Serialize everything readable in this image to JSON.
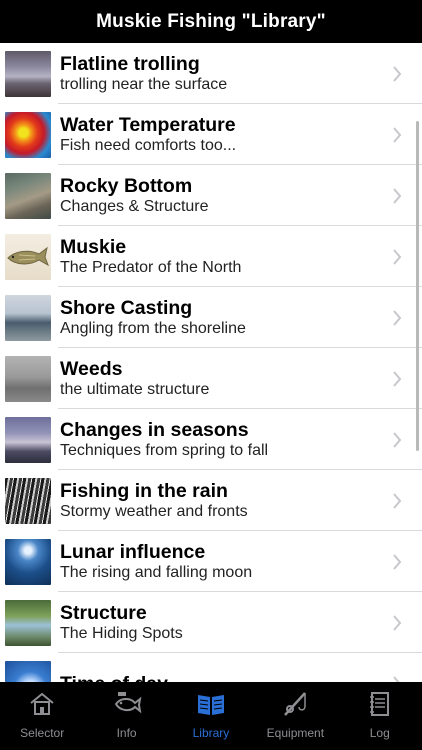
{
  "header": {
    "title": "Muskie Fishing \"Library\""
  },
  "list": {
    "items": [
      {
        "title": "Flatline trolling",
        "subtitle": "trolling near the surface"
      },
      {
        "title": "Water Temperature",
        "subtitle": "Fish need comforts too..."
      },
      {
        "title": "Rocky Bottom",
        "subtitle": "Changes & Structure"
      },
      {
        "title": "Muskie",
        "subtitle": "The Predator of the North"
      },
      {
        "title": "Shore Casting",
        "subtitle": "Angling from the shoreline"
      },
      {
        "title": "Weeds",
        "subtitle": "the ultimate structure"
      },
      {
        "title": "Changes in seasons",
        "subtitle": "Techniques from spring to fall"
      },
      {
        "title": "Fishing in the rain",
        "subtitle": "Stormy weather and fronts"
      },
      {
        "title": "Lunar influence",
        "subtitle": "The rising and falling moon"
      },
      {
        "title": "Structure",
        "subtitle": "The Hiding Spots"
      },
      {
        "title": "Time of day",
        "subtitle": ""
      }
    ]
  },
  "tabs": [
    {
      "label": "Selector",
      "icon": "house-icon",
      "active": false
    },
    {
      "label": "Info",
      "icon": "fish-info-icon",
      "active": false
    },
    {
      "label": "Library",
      "icon": "open-book-icon",
      "active": true
    },
    {
      "label": "Equipment",
      "icon": "fishing-rod-icon",
      "active": false
    },
    {
      "label": "Log",
      "icon": "notebook-icon",
      "active": false
    }
  ],
  "colors": {
    "accent": "#2a6fd6",
    "tab_inactive": "#8e8e93",
    "chevron": "#c7c7cc"
  }
}
